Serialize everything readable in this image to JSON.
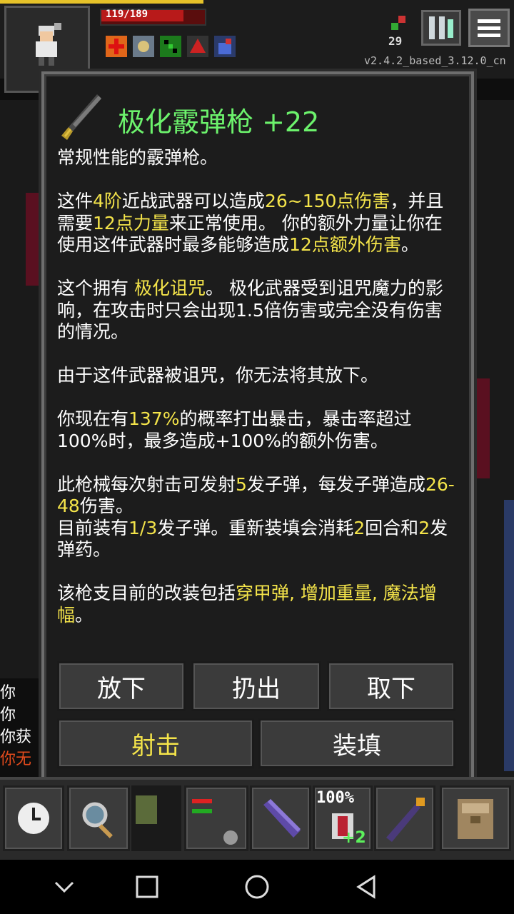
{
  "hud": {
    "hp_text": "119/189",
    "depth": "29",
    "version": "v2.4.2_based_3.12.0_cn",
    "buff_icons": [
      "red-cross-icon",
      "gear-buff-icon",
      "green-buff-icon",
      "red-buff-icon",
      "blue-buff-icon"
    ]
  },
  "item_window": {
    "title": "极化霰弹枪 +22",
    "icon": "shotgun-icon",
    "paragraphs": [
      [
        {
          "t": "常规性能的霰弹枪。"
        }
      ],
      [
        {
          "t": "这件"
        },
        {
          "t": "4阶",
          "h": 1
        },
        {
          "t": "近战武器可以造成"
        },
        {
          "t": "26~150点伤害",
          "h": 1
        },
        {
          "t": "，并且需要"
        },
        {
          "t": "12点力量",
          "h": 1
        },
        {
          "t": "来正常使用。 你的额外力量让你在使用这件武器时最多能够造成"
        },
        {
          "t": "12点额外伤害",
          "h": 1
        },
        {
          "t": "。"
        }
      ],
      [
        {
          "t": "这个拥有 "
        },
        {
          "t": "极化诅咒",
          "h": 1
        },
        {
          "t": "。 极化武器受到诅咒魔力的影响，在攻击时只会出现1.5倍伤害或完全没有伤害的情况。"
        }
      ],
      [
        {
          "t": "由于这件武器被诅咒，你无法将其放下。"
        }
      ],
      [
        {
          "t": "你现在有"
        },
        {
          "t": "137%",
          "h": 1
        },
        {
          "t": "的概率打出暴击，暴击率超过100%时，最多造成+100%的额外伤害。"
        }
      ],
      [
        {
          "t": "此枪械每次射击可发射"
        },
        {
          "t": "5",
          "h": 1
        },
        {
          "t": "发子弹，每发子弹造成"
        },
        {
          "t": "26-48",
          "h": 1
        },
        {
          "t": "伤害。"
        },
        {
          "br": 1
        },
        {
          "t": "目前装有"
        },
        {
          "t": "1/3",
          "h": 1
        },
        {
          "t": "发子弹。重新装填会消耗"
        },
        {
          "t": "2",
          "h": 1
        },
        {
          "t": "回合和"
        },
        {
          "t": "2",
          "h": 1
        },
        {
          "t": "发弹药。"
        }
      ],
      [
        {
          "t": "该枪支目前的改装包括"
        },
        {
          "t": "穿甲弹, 增加重量, 魔法增幅",
          "h": 1
        },
        {
          "t": "。"
        }
      ]
    ],
    "buttons": {
      "drop": "放下",
      "throw": "扔出",
      "unequip": "取下",
      "shoot": "射击",
      "reload": "装填"
    }
  },
  "log": [
    "你",
    "你",
    "你获",
    "你无"
  ],
  "toolbar": {
    "quickslot_percent": "100%",
    "quickslot_bonus": "+2"
  },
  "colors": {
    "title_green": "#6cf26c",
    "highlight_yellow": "#f4e44a",
    "hp_red": "#b81a1a"
  }
}
